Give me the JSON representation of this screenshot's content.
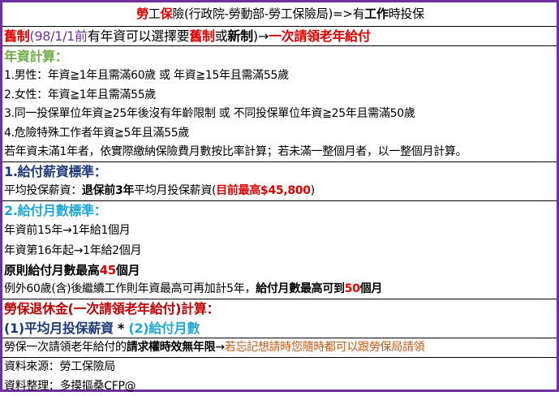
{
  "title": {
    "p1": "勞",
    "p2": "工",
    "p3": "保",
    "p4": "險(行政院-勞動部-勞工保險局)=>有",
    "p5": "工作",
    "p6": "時投保"
  },
  "old_system": {
    "p1": "舊制",
    "p2": "(98/1/1前",
    "p3": "有年資可以選擇要",
    "p4": "舊制",
    "p5": "或",
    "p6": "新制",
    "p7": ")→",
    "p8": "一次請領老年給付"
  },
  "seniority": {
    "heading": "年資計算：",
    "items": [
      "1.男性：年資≧1年且需滿60歲  或  年資≧15年且需滿55歲",
      "2.女性：年資≧1年且需滿55歲",
      "3.同一投保單位年資≧25年後沒有年齡限制  或  不同投保單位年資≧25年且需滿50歲",
      "4.危險特殊工作者年資≧5年且滿55歲",
      "若年資未滿1年者，依實際繳納保險費月數按比率計算；若未滿一整個月者，以一整個月計算。"
    ]
  },
  "salary": {
    "heading": "1.給付薪資標準：",
    "p1": "平均投保薪資：",
    "p2": "退保前3年",
    "p3": "平均月投保薪資(",
    "p4": "目前最高$45,800",
    "p5": ")"
  },
  "months": {
    "heading": "2.給付月數標準：",
    "l1": "年資前15年→1年給1個月",
    "l2": "年資第16年起→1年給2個月",
    "l3a": "原則給付月數最高",
    "l3b": "45",
    "l3c": "個月",
    "l4a": "例外60歲(含)後繼續工作則年資最高可再加計5年，",
    "l4b": "給付月數最高可到",
    "l4c": "50",
    "l4d": "個月"
  },
  "formula": {
    "heading": "勞保退休金(一次請領老年給付)計算：",
    "p1": "(1)平均月投保薪資",
    "p2": " * ",
    "p3": "(2)給付月數"
  },
  "claim": {
    "p1": "勞保一次請領老年給付的",
    "p2": "請求權時效無年限",
    "p3": "→",
    "p4": "若忘記想請時您隨時都可以跟勞保局請領"
  },
  "source": {
    "l1": "資料來源：勞工保險局",
    "l2": "資料整理：多摸摳桑CFP@"
  }
}
